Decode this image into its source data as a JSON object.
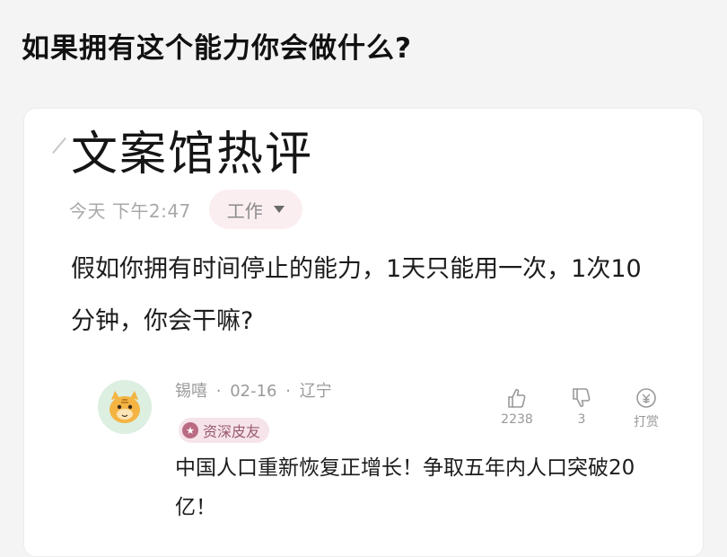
{
  "header": {
    "question": "如果拥有这个能力你会做什么?"
  },
  "note": {
    "heading": "文案馆热评",
    "date": "今天 下午2:47",
    "tag": "工作",
    "body": "假如你拥有时间停止的能力，1天只能用一次，1次10分钟，你会干嘛?"
  },
  "comment": {
    "user": "锡嘻",
    "date": "02-16",
    "location": "辽宁",
    "badge": "资深皮友",
    "text": "中国人口重新恢复正增长！争取五年内人口突破20亿！",
    "actions": {
      "like_icon": "thumbs-up-icon",
      "like_count": "2238",
      "dislike_icon": "thumbs-down-icon",
      "dislike_count": "3",
      "reward_icon": "reward-icon",
      "reward_label": "打赏"
    }
  },
  "colors": {
    "tag_bg": "#fbeef1",
    "badge_bg": "#f6e4ea",
    "badge_accent": "#b96b82"
  }
}
